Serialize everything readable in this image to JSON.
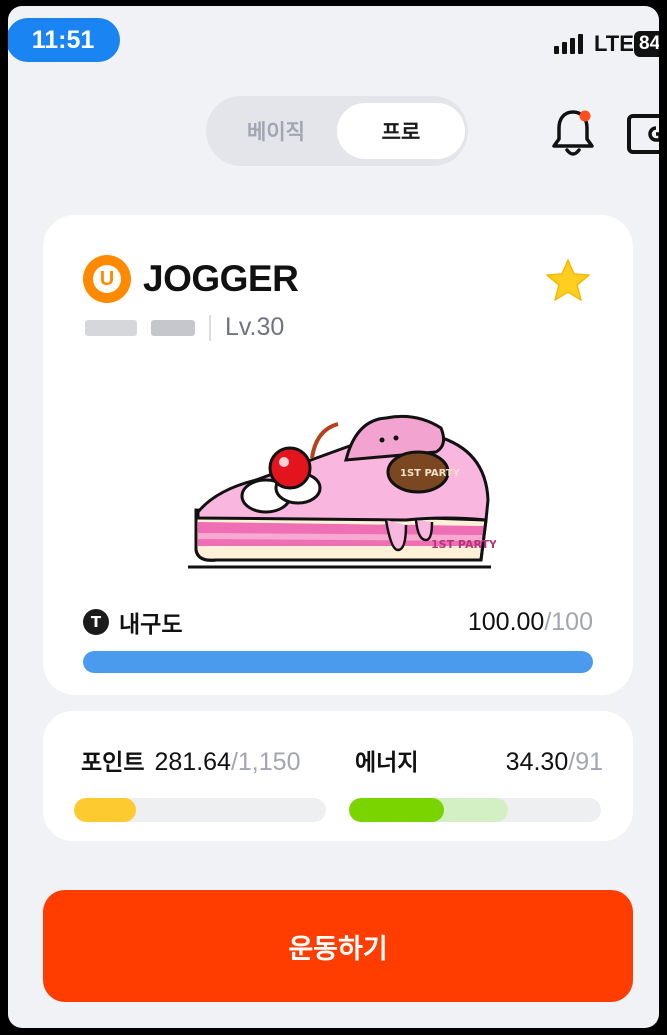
{
  "status_bar": {
    "time": "11:51",
    "network": "LTE",
    "battery": "84"
  },
  "mode_toggle": {
    "basic_label": "베이직",
    "pro_label": "프로",
    "selected": "pro"
  },
  "header_icons": [
    "bell-icon",
    "wallet-icon"
  ],
  "card": {
    "brand_logo_letter": "U",
    "brand_name": "JOGGER",
    "level": "Lv.30",
    "favorite": true,
    "cake_labels": [
      "1ST PARTY",
      "1ST PARTY"
    ],
    "durability": {
      "icon_letter": "T",
      "label": "내구도",
      "value": "100.00",
      "separator": "/",
      "max": "100",
      "fill_fraction": 1.0,
      "bar_color": "#4a9bee"
    }
  },
  "stats": {
    "points": {
      "label": "포인트",
      "value": "281.64",
      "separator": "/",
      "max": "1,150",
      "fill_fraction": 0.245,
      "bar_color": "#fdcb2f"
    },
    "energy": {
      "label": "에너지",
      "value": "34.30",
      "separator": "/",
      "max": "91",
      "fill_fraction": 0.377,
      "secondary_fill_fraction": 0.63,
      "bar_color": "#79d400"
    }
  },
  "cta_label": "운동하기",
  "colors": {
    "accent": "#ff3d00",
    "status_pill": "#1b84f3",
    "background": "#f1f2f5"
  }
}
